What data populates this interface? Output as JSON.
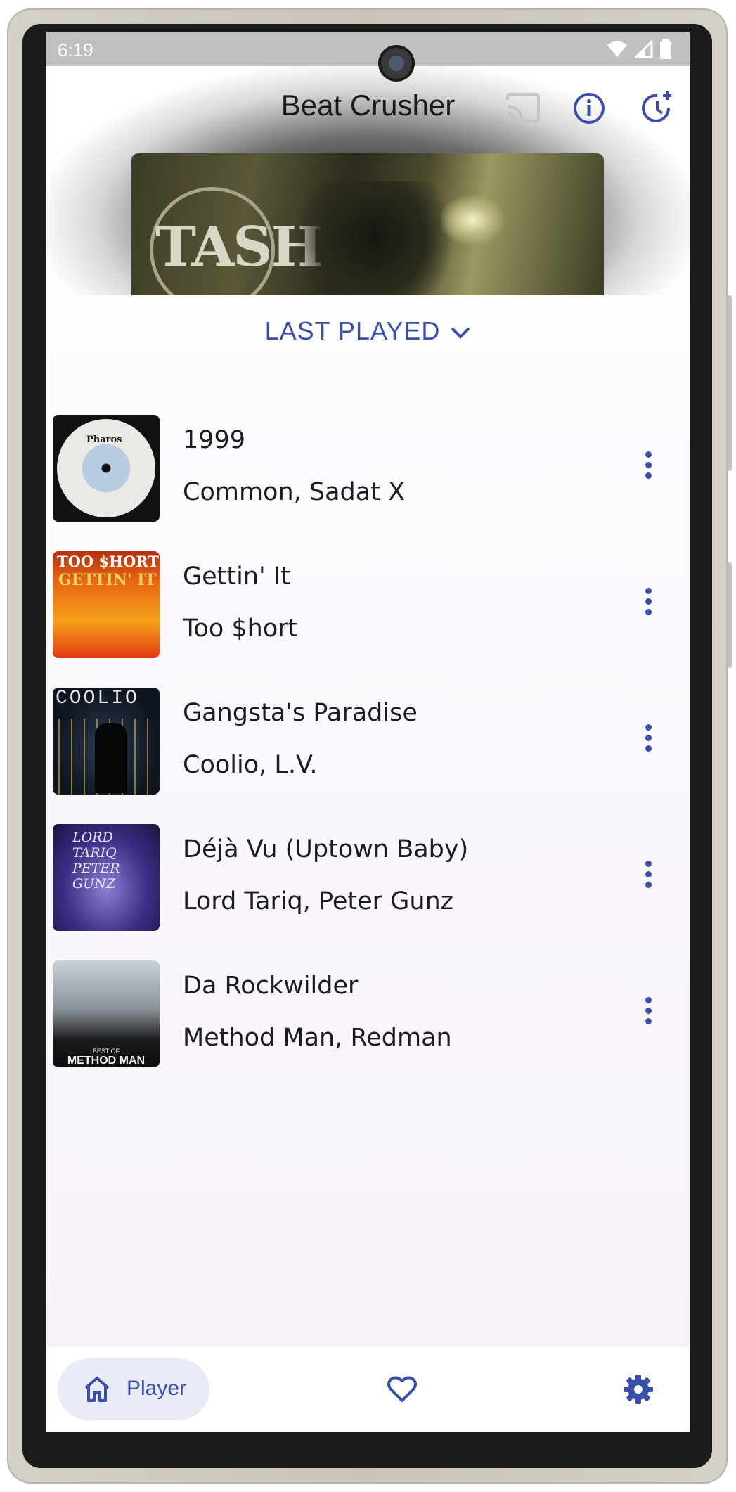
{
  "status_bar": {
    "time": "6:19"
  },
  "app": {
    "title": "Beat Crusher"
  },
  "now_playing": {
    "album_art_text": "TASH"
  },
  "sheet": {
    "header": "LAST PLAYED",
    "tracks": [
      {
        "title": "1999",
        "artist": "Common, Sadat X",
        "art": "Pharos"
      },
      {
        "title": "Gettin' It",
        "artist": "Too $hort",
        "art_line1": "TOO $HORT",
        "art_line2": "GETTIN' IT"
      },
      {
        "title": "Gangsta's Paradise",
        "artist": "Coolio, L.V.",
        "art": "COOLIO"
      },
      {
        "title": "Déjà Vu (Uptown Baby)",
        "artist": "Lord Tariq, Peter Gunz",
        "art_line1": "LORD TARIQ",
        "art_line2": "PETER GUNZ"
      },
      {
        "title": "Da Rockwilder",
        "artist": "Method Man, Redman",
        "art_small": "BEST OF",
        "art": "METHOD MAN"
      }
    ]
  },
  "nav": {
    "player_label": "Player",
    "items": [
      "home-icon",
      "heart-icon",
      "gear-icon"
    ]
  },
  "colors": {
    "accent": "#3a4faa",
    "nav_pill": "#e9ebf7"
  }
}
